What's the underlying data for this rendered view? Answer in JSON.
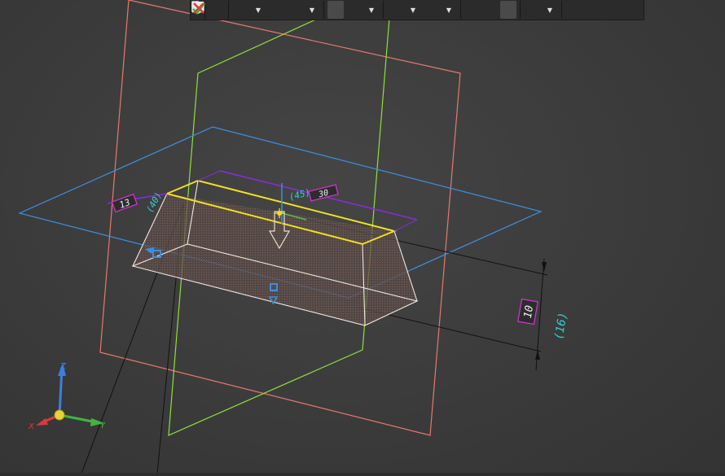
{
  "toolbar": {
    "buttons": [
      {
        "name": "grip-handle",
        "icon": "grip-icon"
      },
      {
        "name": "sketch-button",
        "icon": "sketch-icon"
      },
      {
        "name": "zoom-button",
        "icon": "zoom-icon",
        "dropdown": true
      },
      {
        "name": "view-orientation-button",
        "icon": "orientation-icon"
      },
      {
        "name": "triad-button",
        "icon": "triad-icon",
        "dropdown": true
      },
      {
        "name": "shaded-display-button",
        "icon": "solid-cube-icon"
      },
      {
        "name": "wireframe-display-button",
        "icon": "wire-cube-icon",
        "dropdown": true
      },
      {
        "name": "hide-show-button",
        "icon": "eye-icon",
        "dropdown": true
      },
      {
        "name": "render-button",
        "icon": "render-icon",
        "dropdown": true
      },
      {
        "name": "relations-button",
        "icon": "relations-icon"
      },
      {
        "name": "section-view-button",
        "icon": "section-icon"
      },
      {
        "name": "layers-button",
        "icon": "layers-icon"
      },
      {
        "name": "filter-button",
        "icon": "filter-icon",
        "dropdown": true
      },
      {
        "name": "eyedropper-button",
        "icon": "eyedropper-icon"
      },
      {
        "name": "accept-button",
        "icon": "checkmark-icon"
      },
      {
        "name": "cancel-button",
        "icon": "x-icon"
      }
    ],
    "colors": {
      "accept": "#2fbf3f",
      "cancel": "#e23b3b"
    }
  },
  "annotations": {
    "dim_13": "13",
    "dim_30": "30",
    "dim_10": "10",
    "driven_left": "(40)",
    "driven_top": "(45)",
    "driven_right": "(16)"
  },
  "triad": {
    "x": "X",
    "y": "Y",
    "z": "Z"
  },
  "colors": {
    "front_plane": "#e8786e",
    "right_plane": "#8fe03a",
    "top_plane": "#3c8fe0",
    "sketch_yellow": "#f0e020",
    "dimension_purple": "#8a2be2",
    "dimension_box": "#d030d0",
    "driven_cyan": "#30d0d8"
  }
}
